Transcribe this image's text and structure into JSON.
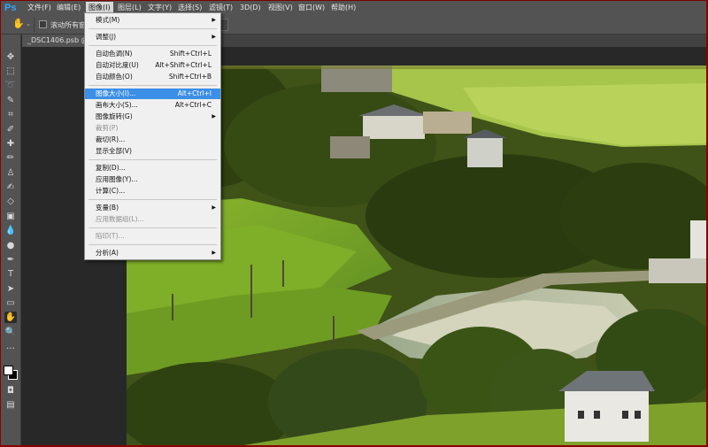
{
  "menubar": {
    "logo": "Ps",
    "items": [
      "文件(F)",
      "编辑(E)",
      "图像(I)",
      "图层(L)",
      "文字(Y)",
      "选择(S)",
      "滤镜(T)",
      "3D(D)",
      "视图(V)",
      "窗口(W)",
      "帮助(H)"
    ],
    "active_index": 2
  },
  "options": {
    "scroll_all_windows": "滚动所有窗"
  },
  "document": {
    "tab_title": "_DSC1406.psb @ 2"
  },
  "image_menu": {
    "items": [
      {
        "label": "模式(M)",
        "shortcut": "",
        "submenu": true,
        "disabled": false
      },
      {
        "label": "调整(J)",
        "shortcut": "",
        "submenu": true,
        "disabled": false
      },
      {
        "label": "自动色调(N)",
        "shortcut": "Shift+Ctrl+L",
        "submenu": false,
        "disabled": false
      },
      {
        "label": "自动对比度(U)",
        "shortcut": "Alt+Shift+Ctrl+L",
        "submenu": false,
        "disabled": false
      },
      {
        "label": "自动颜色(O)",
        "shortcut": "Shift+Ctrl+B",
        "submenu": false,
        "disabled": false
      },
      {
        "label": "图像大小(I)...",
        "shortcut": "Alt+Ctrl+I",
        "submenu": false,
        "disabled": false,
        "highlighted": true
      },
      {
        "label": "画布大小(S)...",
        "shortcut": "Alt+Ctrl+C",
        "submenu": false,
        "disabled": false
      },
      {
        "label": "图像旋转(G)",
        "shortcut": "",
        "submenu": true,
        "disabled": false
      },
      {
        "label": "裁剪(P)",
        "shortcut": "",
        "submenu": false,
        "disabled": true
      },
      {
        "label": "裁切(R)...",
        "shortcut": "",
        "submenu": false,
        "disabled": false
      },
      {
        "label": "显示全部(V)",
        "shortcut": "",
        "submenu": false,
        "disabled": false
      },
      {
        "label": "复制(D)...",
        "shortcut": "",
        "submenu": false,
        "disabled": false
      },
      {
        "label": "应用图像(Y)...",
        "shortcut": "",
        "submenu": false,
        "disabled": false
      },
      {
        "label": "计算(C)...",
        "shortcut": "",
        "submenu": false,
        "disabled": false
      },
      {
        "label": "变量(B)",
        "shortcut": "",
        "submenu": true,
        "disabled": false
      },
      {
        "label": "应用数据组(L)...",
        "shortcut": "",
        "submenu": false,
        "disabled": true
      },
      {
        "label": "陷印(T)...",
        "shortcut": "",
        "submenu": false,
        "disabled": true
      },
      {
        "label": "分析(A)",
        "shortcut": "",
        "submenu": true,
        "disabled": false
      }
    ]
  },
  "toolbox": {
    "tools": [
      "move-icon",
      "marquee-icon",
      "lasso-icon",
      "quick-select-icon",
      "crop-icon",
      "eyedropper-icon",
      "healing-icon",
      "brush-icon",
      "clone-stamp-icon",
      "history-brush-icon",
      "eraser-icon",
      "gradient-icon",
      "blur-icon",
      "dodge-icon",
      "pen-icon",
      "type-icon",
      "path-select-icon",
      "rectangle-icon",
      "hand-icon",
      "zoom-icon",
      "more-icon"
    ],
    "selected_tool": "hand-icon"
  },
  "colors": {
    "accent": "#3c8fe6",
    "foreground": "#ffffff",
    "background": "#000000"
  }
}
